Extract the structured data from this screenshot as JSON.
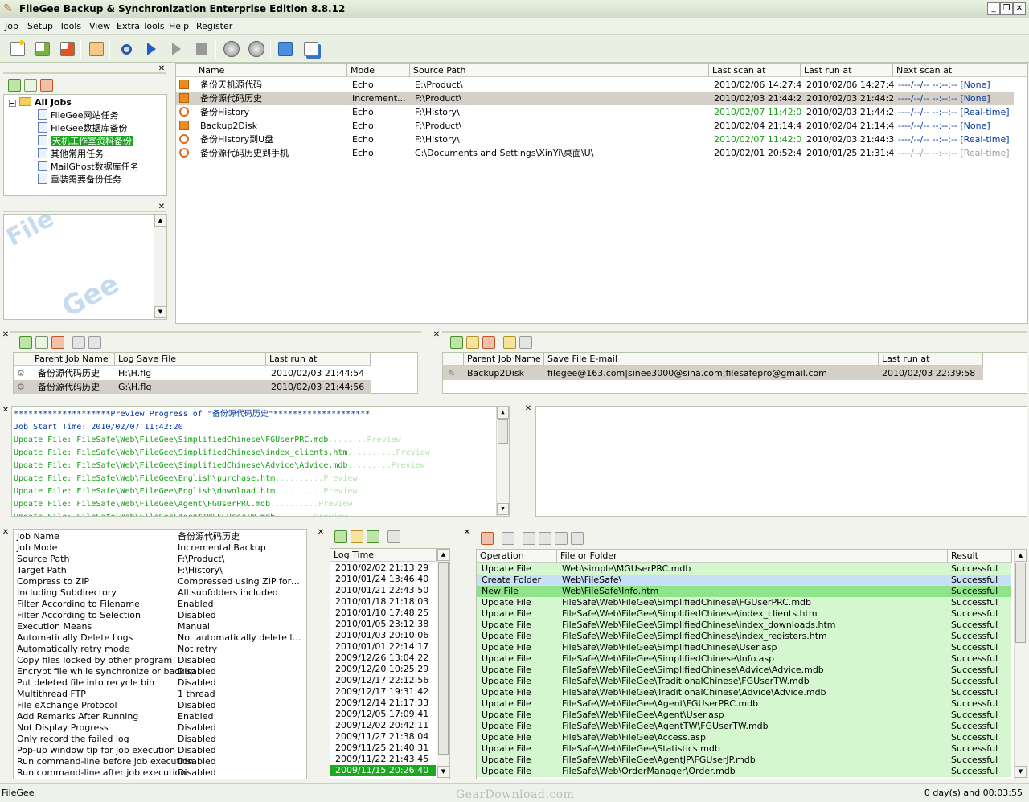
{
  "window": {
    "title": "FileGee Backup & Synchronization Enterprise Edition 8.8.12"
  },
  "menu": [
    "Job",
    "Setup",
    "Tools",
    "View",
    "Extra Tools",
    "Help",
    "Register"
  ],
  "toolbar": [
    "new-job",
    "edit-job",
    "delete-job",
    "book",
    "find",
    "run",
    "run-all",
    "stop",
    "scan",
    "settings",
    "export",
    "import"
  ],
  "tree": {
    "root": "All Jobs",
    "items": [
      "FileGee网站任务",
      "FileGee数据库备份",
      "天机工作室资料备份",
      "其他常用任务",
      "MailGhost数据库任务",
      "重装需要备份任务"
    ],
    "selected": 2
  },
  "jobs": {
    "columns": [
      "Name",
      "Mode",
      "Source Path",
      "Last scan at",
      "Last run at",
      "Next scan at"
    ],
    "rows": [
      {
        "name": "备份天机源代码",
        "mode": "Echo",
        "source": "E:\\Product\\",
        "last_scan": "2010/02/06 14:27:43",
        "last_run": "2010/02/06 14:27:43",
        "next_scan": "----/--/-- --:--:-- [None]",
        "icon": "orange",
        "scan_color": "",
        "next_color": "blue"
      },
      {
        "name": "备份源代码历史",
        "mode": "Increment...",
        "source": "F:\\Product\\",
        "last_scan": "2010/02/03 21:44:26",
        "last_run": "2010/02/03 21:44:26",
        "next_scan": "----/--/-- --:--:-- [None]",
        "icon": "orange",
        "scan_color": "",
        "next_color": "blue"
      },
      {
        "name": "备份History",
        "mode": "Echo",
        "source": "F:\\History\\",
        "last_scan": "2010/02/07 11:42:08",
        "last_run": "2010/02/03 21:44:29",
        "next_scan": "----/--/-- --:--:-- [Real-time]",
        "icon": "clock",
        "scan_color": "green",
        "next_color": "blue"
      },
      {
        "name": "Backup2Disk",
        "mode": "Echo",
        "source": "F:\\Product\\",
        "last_scan": "2010/02/04 21:14:46",
        "last_run": "2010/02/04 21:14:46",
        "next_scan": "----/--/-- --:--:-- [None]",
        "icon": "orange",
        "scan_color": "",
        "next_color": "blue"
      },
      {
        "name": "备份History到U盘",
        "mode": "Echo",
        "source": "F:\\History\\",
        "last_scan": "2010/02/07 11:42:08",
        "last_run": "2010/02/03 21:44:30",
        "next_scan": "----/--/-- --:--:-- [Real-time]",
        "icon": "clock",
        "scan_color": "green",
        "next_color": "blue"
      },
      {
        "name": "备份源代码历史到手机",
        "mode": "Echo",
        "source": "C:\\Documents and Settings\\XinYi\\桌面\\U\\",
        "last_scan": "2010/02/01 20:52:48",
        "last_run": "2010/01/25 21:31:48",
        "next_scan": "----/--/-- --:--:-- [Real-time]",
        "icon": "clock",
        "scan_color": "",
        "next_color": "gray"
      }
    ],
    "selected": 1
  },
  "logsave": {
    "columns": [
      "Parent Job Name",
      "Log Save File",
      "Last run at"
    ],
    "rows": [
      [
        "备份源代码历史",
        "H:\\H.flg",
        "2010/02/03 21:44:54"
      ],
      [
        "备份源代码历史",
        "G:\\H.flg",
        "2010/02/03 21:44:56"
      ]
    ]
  },
  "emailsave": {
    "columns": [
      "Parent Job Name",
      "Save File E-mail",
      "Last run at"
    ],
    "rows": [
      [
        "Backup2Disk",
        "filegee@163.com|sinee3000@sina.com;filesafepro@gmail.com",
        "2010/02/03 22:39:58"
      ]
    ]
  },
  "progress": {
    "lines": [
      {
        "text": "********************Preview Progress of \"备份源代码历史\"********************",
        "cls": "blue"
      },
      {
        "text": "Job Start Time: 2010/02/07 11:42:20",
        "cls": "blue"
      },
      {
        "text": "Update File: FileSafe\\Web\\FileGee\\SimplifiedChinese\\FGUserPRC.mdb",
        "dots": "........Preview",
        "cls": "green"
      },
      {
        "text": "Update File: FileSafe\\Web\\FileGee\\SimplifiedChinese\\index_clients.htm",
        "dots": "..........Preview",
        "cls": "green"
      },
      {
        "text": "Update File: FileSafe\\Web\\FileGee\\SimplifiedChinese\\Advice\\Advice.mdb",
        "dots": ".........Preview",
        "cls": "green"
      },
      {
        "text": "Update File: FileSafe\\Web\\FileGee\\English\\purchase.htm",
        "dots": "..........Preview",
        "cls": "green"
      },
      {
        "text": "Update File: FileSafe\\Web\\FileGee\\English\\download.htm",
        "dots": "..........Preview",
        "cls": "green"
      },
      {
        "text": "Update File: FileSafe\\Web\\FileGee\\Agent\\FGUserPRC.mdb",
        "dots": "..........Preview",
        "cls": "green"
      },
      {
        "text": "Update File: FileSafe\\Web\\FileGee\\AgentTW\\FGUserTW.mdb",
        "dots": "........Preview",
        "cls": "green"
      }
    ]
  },
  "props": [
    [
      "Job Name",
      "备份源代码历史"
    ],
    [
      "Job Mode",
      "Incremental Backup"
    ],
    [
      "Source Path",
      "F:\\Product\\"
    ],
    [
      "Target Path",
      "F:\\History\\"
    ],
    [
      "Compress to ZIP",
      "Compressed using ZIP format"
    ],
    [
      "Including Subdirectory",
      "All subfolders included"
    ],
    [
      "Filter According to Filename",
      "Enabled"
    ],
    [
      "Filter According to Selection",
      "Disabled"
    ],
    [
      "Execution Means",
      "Manual"
    ],
    [
      "Automatically Delete Logs",
      "Not automatically delete logs"
    ],
    [
      "Automatically retry mode",
      "Not retry"
    ],
    [
      "Copy files locked by other program",
      "Disabled"
    ],
    [
      "Encrypt file while synchronize or backup",
      "Disabled"
    ],
    [
      "Put deleted file into recycle bin",
      "Disabled"
    ],
    [
      "Multithread FTP",
      "1 thread"
    ],
    [
      "File eXchange Protocol",
      "Disabled"
    ],
    [
      "Add Remarks After Running",
      "Enabled"
    ],
    [
      "Not Display Progress",
      "Disabled"
    ],
    [
      "Only record the failed log",
      "Disabled"
    ],
    [
      "Pop-up window tip for job execution",
      "Disabled"
    ],
    [
      "Run command-line before job execution",
      "Disabled"
    ],
    [
      "Run command-line after job execution",
      "Disabled"
    ]
  ],
  "logtime": {
    "header": "Log Time",
    "rows": [
      "2010/02/02 21:13:29",
      "2010/01/24 13:46:40",
      "2010/01/21 22:43:50",
      "2010/01/18 21:18:03",
      "2010/01/10 17:48:25",
      "2010/01/05 23:12:38",
      "2010/01/03 20:10:06",
      "2010/01/01 22:14:17",
      "2009/12/26 13:04:22",
      "2009/12/20 10:25:29",
      "2009/12/17 22:12:56",
      "2009/12/17 19:31:42",
      "2009/12/14 21:17:33",
      "2009/12/05 17:09:41",
      "2009/12/02 20:42:11",
      "2009/11/27 21:38:04",
      "2009/11/25 21:40:31",
      "2009/11/22 21:43:45",
      "2009/11/15 20:26:40"
    ],
    "selected": 18
  },
  "ops": {
    "columns": [
      "Operation",
      "File or Folder",
      "Result"
    ],
    "rows": [
      [
        "Update File",
        "Web\\simple\\MGUserPRC.mdb",
        "Successful"
      ],
      [
        "Create Folder",
        "Web\\FileSafe\\",
        "Successful"
      ],
      [
        "New File",
        "Web\\FileSafe\\Info.htm",
        "Successful"
      ],
      [
        "Update File",
        "FileSafe\\Web\\FileGee\\SimplifiedChinese\\FGUserPRC.mdb",
        "Successful"
      ],
      [
        "Update File",
        "FileSafe\\Web\\FileGee\\SimplifiedChinese\\index_clients.htm",
        "Successful"
      ],
      [
        "Update File",
        "FileSafe\\Web\\FileGee\\SimplifiedChinese\\index_downloads.htm",
        "Successful"
      ],
      [
        "Update File",
        "FileSafe\\Web\\FileGee\\SimplifiedChinese\\index_registers.htm",
        "Successful"
      ],
      [
        "Update File",
        "FileSafe\\Web\\FileGee\\SimplifiedChinese\\User.asp",
        "Successful"
      ],
      [
        "Update File",
        "FileSafe\\Web\\FileGee\\SimplifiedChinese\\Info.asp",
        "Successful"
      ],
      [
        "Update File",
        "FileSafe\\Web\\FileGee\\SimplifiedChinese\\Advice\\Advice.mdb",
        "Successful"
      ],
      [
        "Update File",
        "FileSafe\\Web\\FileGee\\TraditionalChinese\\FGUserTW.mdb",
        "Successful"
      ],
      [
        "Update File",
        "FileSafe\\Web\\FileGee\\TraditionalChinese\\Advice\\Advice.mdb",
        "Successful"
      ],
      [
        "Update File",
        "FileSafe\\Web\\FileGee\\Agent\\FGUserPRC.mdb",
        "Successful"
      ],
      [
        "Update File",
        "FileSafe\\Web\\FileGee\\Agent\\User.asp",
        "Successful"
      ],
      [
        "Update File",
        "FileSafe\\Web\\FileGee\\AgentTW\\FGUserTW.mdb",
        "Successful"
      ],
      [
        "Update File",
        "FileSafe\\Web\\FileGee\\Access.asp",
        "Successful"
      ],
      [
        "Update File",
        "FileSafe\\Web\\FileGee\\Statistics.mdb",
        "Successful"
      ],
      [
        "Update File",
        "FileSafe\\Web\\FileGee\\AgentJP\\FGUserJP.mdb",
        "Successful"
      ],
      [
        "Update File",
        "FileSafe\\Web\\OrderManager\\Order.mdb",
        "Successful"
      ]
    ],
    "highlight": {
      "1": "#c7e0f7",
      "2": "#8fe48a"
    }
  },
  "status": {
    "left": "FileGee",
    "right": "0 day(s) and 00:03:55"
  },
  "watermark": "GearDownload.com"
}
